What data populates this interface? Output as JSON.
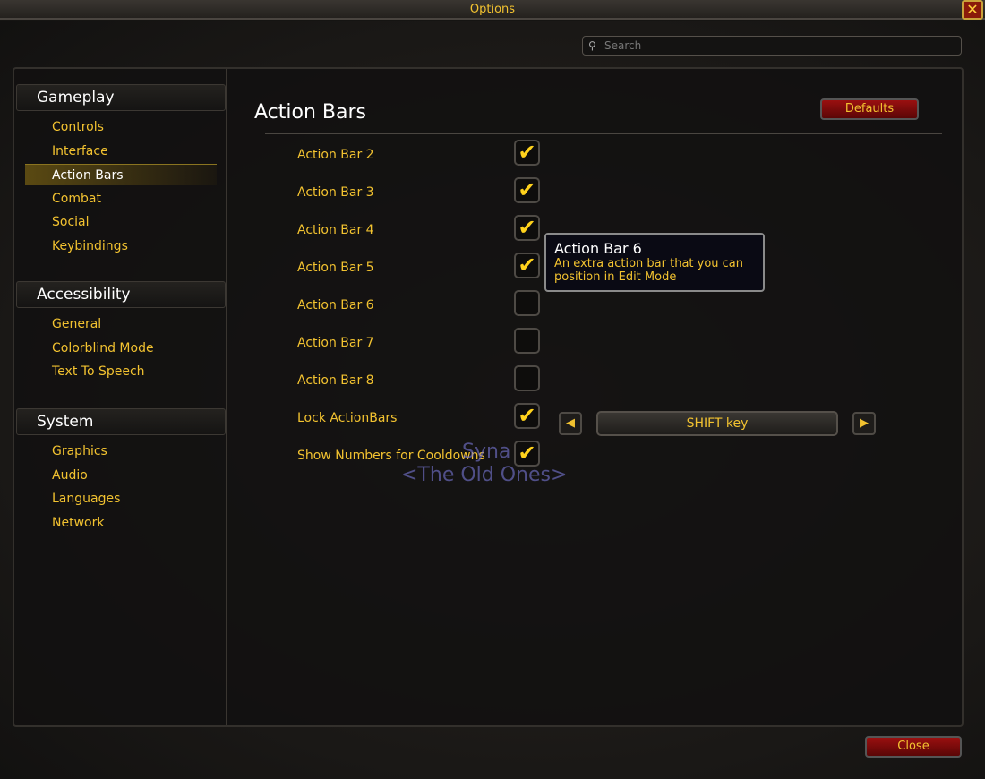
{
  "window": {
    "title": "Options",
    "close_icon": "close-x-icon"
  },
  "search": {
    "placeholder": "Search",
    "icon": "search-icon"
  },
  "sidebar": {
    "categories": [
      {
        "label": "Gameplay",
        "items": [
          "Controls",
          "Interface",
          "Action Bars",
          "Combat",
          "Social",
          "Keybindings"
        ]
      },
      {
        "label": "Accessibility",
        "items": [
          "General",
          "Colorblind Mode",
          "Text To Speech"
        ]
      },
      {
        "label": "System",
        "items": [
          "Graphics",
          "Audio",
          "Languages",
          "Network"
        ]
      }
    ],
    "selected": "Action Bars"
  },
  "main": {
    "title": "Action Bars",
    "defaults_label": "Defaults",
    "settings": [
      {
        "label": "Action Bar 2",
        "checked": true
      },
      {
        "label": "Action Bar 3",
        "checked": true
      },
      {
        "label": "Action Bar 4",
        "checked": true
      },
      {
        "label": "Action Bar 5",
        "checked": true
      },
      {
        "label": "Action Bar 6",
        "checked": false
      },
      {
        "label": "Action Bar 7",
        "checked": false
      },
      {
        "label": "Action Bar 8",
        "checked": false
      },
      {
        "label": "Lock ActionBars",
        "checked": true
      },
      {
        "label": "Show Numbers for Cooldowns",
        "checked": true
      }
    ],
    "lock_key": {
      "value": "SHIFT key"
    }
  },
  "tooltip": {
    "title": "Action Bar 6",
    "description": "An extra action bar that you can position in Edit Mode"
  },
  "background": {
    "name": "Syna",
    "guild": "<The Old Ones>"
  },
  "footer": {
    "close_label": "Close"
  },
  "colors": {
    "gold": "#f2c230",
    "button_red": "#9a1010",
    "tooltip_bg": "#0a0a14"
  }
}
